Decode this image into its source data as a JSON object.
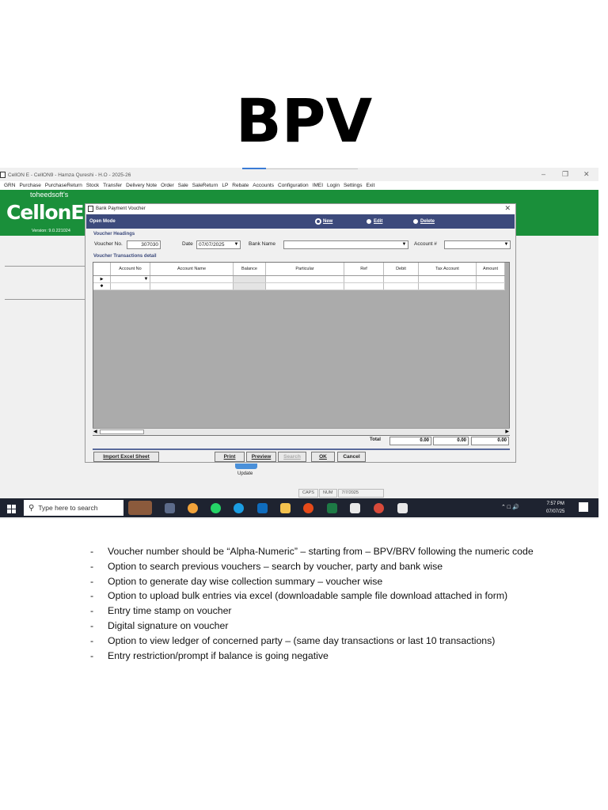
{
  "slide": {
    "title": "BPV"
  },
  "app": {
    "window_title": "CellON E - CellON9 - Hamza Qureshi - H.O - 2025-26",
    "menu": [
      "GRN",
      "Purchase",
      "PurchaseReturn",
      "Stock",
      "Transfer",
      "Delivery Note",
      "Order",
      "Sale",
      "SaleReturn",
      "LP",
      "Rebate",
      "Accounts",
      "Configuration",
      "IMEI",
      "Login",
      "Settings",
      "Exit"
    ],
    "logo": {
      "top_text": "toheedsoft's",
      "main_text": "CellonE",
      "version": "Version: 9.0.221024"
    },
    "brand_color": "#1a8f3a"
  },
  "dialog": {
    "title": "Bank Payment Voucher",
    "open_mode_label": "Open Mode",
    "modes": [
      {
        "label": "New",
        "selected": true
      },
      {
        "label": "Edit",
        "selected": false
      },
      {
        "label": "Delete",
        "selected": false
      }
    ],
    "voucher_headings_label": "Voucher Headings",
    "voucher_no_label": "Voucher No.",
    "voucher_no_value": "307030",
    "date_label": "Date",
    "date_value": "07/07/2025",
    "bank_name_label": "Bank Name",
    "bank_name_value": "",
    "account_label": "Account #",
    "account_value": "",
    "transactions_label": "Voucher Transactions detail",
    "columns": [
      "Account No",
      "Account Name",
      "Balance",
      "Particular",
      "Ref",
      "Debit",
      "Tax Account",
      "Amount"
    ],
    "row_markers": [
      "▶",
      "✱"
    ],
    "total_label": "Total",
    "totals": [
      "0.00",
      "0.00",
      "0.00"
    ],
    "buttons": {
      "import": "Import Excel Sheet",
      "print": "Print",
      "preview": "Preview",
      "search": "Search",
      "ok": "OK",
      "cancel": "Cancel"
    }
  },
  "update_label": "Update",
  "statusbar": [
    "CAPS",
    "NUM",
    "7/7/2025"
  ],
  "taskbar": {
    "search_placeholder": "Type here to search",
    "time": "7:57 PM",
    "date": "07/07/25"
  },
  "notes": [
    "Voucher number should be “Alpha-Numeric” – starting from – BPV/BRV following the numeric code",
    "Option to search previous vouchers – search by voucher, party and bank wise",
    "Option to generate day wise collection summary – voucher wise",
    "Option to upload bulk entries via excel (downloadable sample file download attached in form)",
    "Entry time stamp on voucher",
    "Digital signature on voucher",
    "Option to view ledger of concerned party – (same day transactions or last 10 transactions)",
    "Entry restriction/prompt if balance is going negative"
  ]
}
